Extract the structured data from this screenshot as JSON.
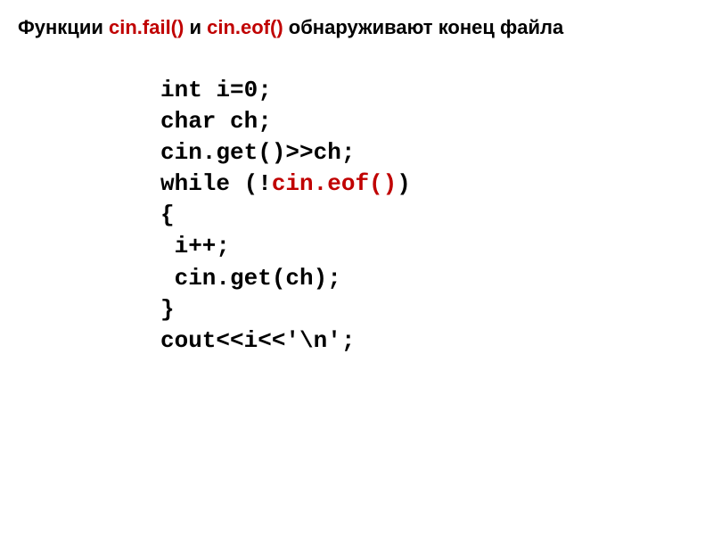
{
  "heading": {
    "prefix": "Функции ",
    "fn1": "cin.fail()",
    "mid": " и ",
    "fn2": "cin.eof()",
    "suffix": " обнаруживают конец файла"
  },
  "code": {
    "line1": "int i=0;",
    "line2": "char ch;",
    "line3": "cin.get()>>ch;",
    "line4_prefix": "while (!",
    "line4_hl": "cin.eof()",
    "line4_suffix": ")",
    "line5": "{",
    "line6": " i++;",
    "line7": " cin.get(ch);",
    "line8": "}",
    "line9": "cout<<i<<'\\n';"
  }
}
